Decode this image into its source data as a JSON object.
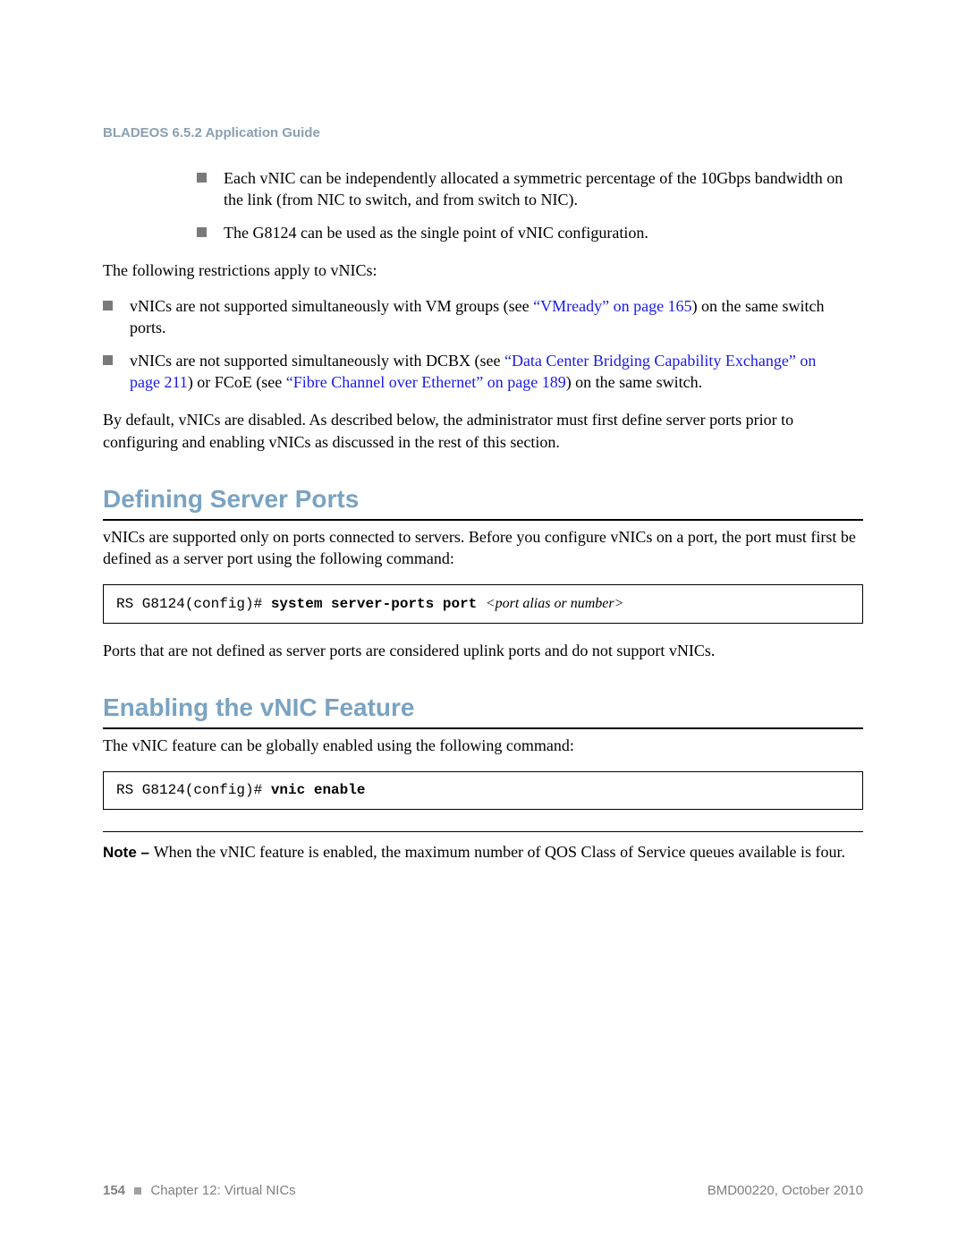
{
  "header": {
    "running_head": "BLADEOS 6.5.2 Application Guide"
  },
  "lists": {
    "intro_items": [
      "Each vNIC can be independently allocated a symmetric percentage of the 10Gbps bandwidth on the link (from NIC to switch, and from switch to NIC).",
      "The G8124 can be used as the single point of vNIC configuration."
    ]
  },
  "paras": {
    "restrictions_intro": "The following restrictions apply to vNICs:",
    "restrict_b1_pre": "vNICs are not supported simultaneously with VM groups (see ",
    "restrict_b1_link": "“VMready” on page 165",
    "restrict_b1_post": ") on the same switch ports.",
    "restrict_b2_pre": "vNICs are not supported simultaneously with DCBX (see ",
    "restrict_b2_link1": "“Data Center Bridging Capability Exchange” on page 211",
    "restrict_b2_mid": ") or FCoE (see ",
    "restrict_b2_link2": "“Fibre Channel over Ethernet” on page 189",
    "restrict_b2_post": ") on the same switch.",
    "default_para": "By default, vNICs are disabled. As described below, the administrator must first define server ports prior to configuring and enabling vNICs as discussed in the rest of this section.",
    "server_ports_intro": "vNICs are supported only on ports connected to servers. Before you configure vNICs on a port, the port must first be defined as a server port using the following command:",
    "server_ports_outro": "Ports that are not defined as server ports are considered uplink ports and do not support vNICs.",
    "enable_intro": "The vNIC feature can be globally enabled using the following command:",
    "note_label": "Note – ",
    "note_body": "When the vNIC feature is enabled, the maximum number of QOS Class of Service queues available is four."
  },
  "sections": {
    "defining_server_ports": "Defining Server Ports",
    "enabling_vnic": "Enabling the vNIC Feature"
  },
  "code": {
    "server_ports": {
      "prompt": "RS G8124(config)# ",
      "cmd": "system server-ports port ",
      "arg": "<port alias or number>"
    },
    "vnic_enable": {
      "prompt": "RS G8124(config)# ",
      "cmd": "vnic enable"
    }
  },
  "footer": {
    "page_number": "154",
    "chapter": "Chapter 12: Virtual NICs",
    "doc_id": "BMD00220, October 2010"
  }
}
